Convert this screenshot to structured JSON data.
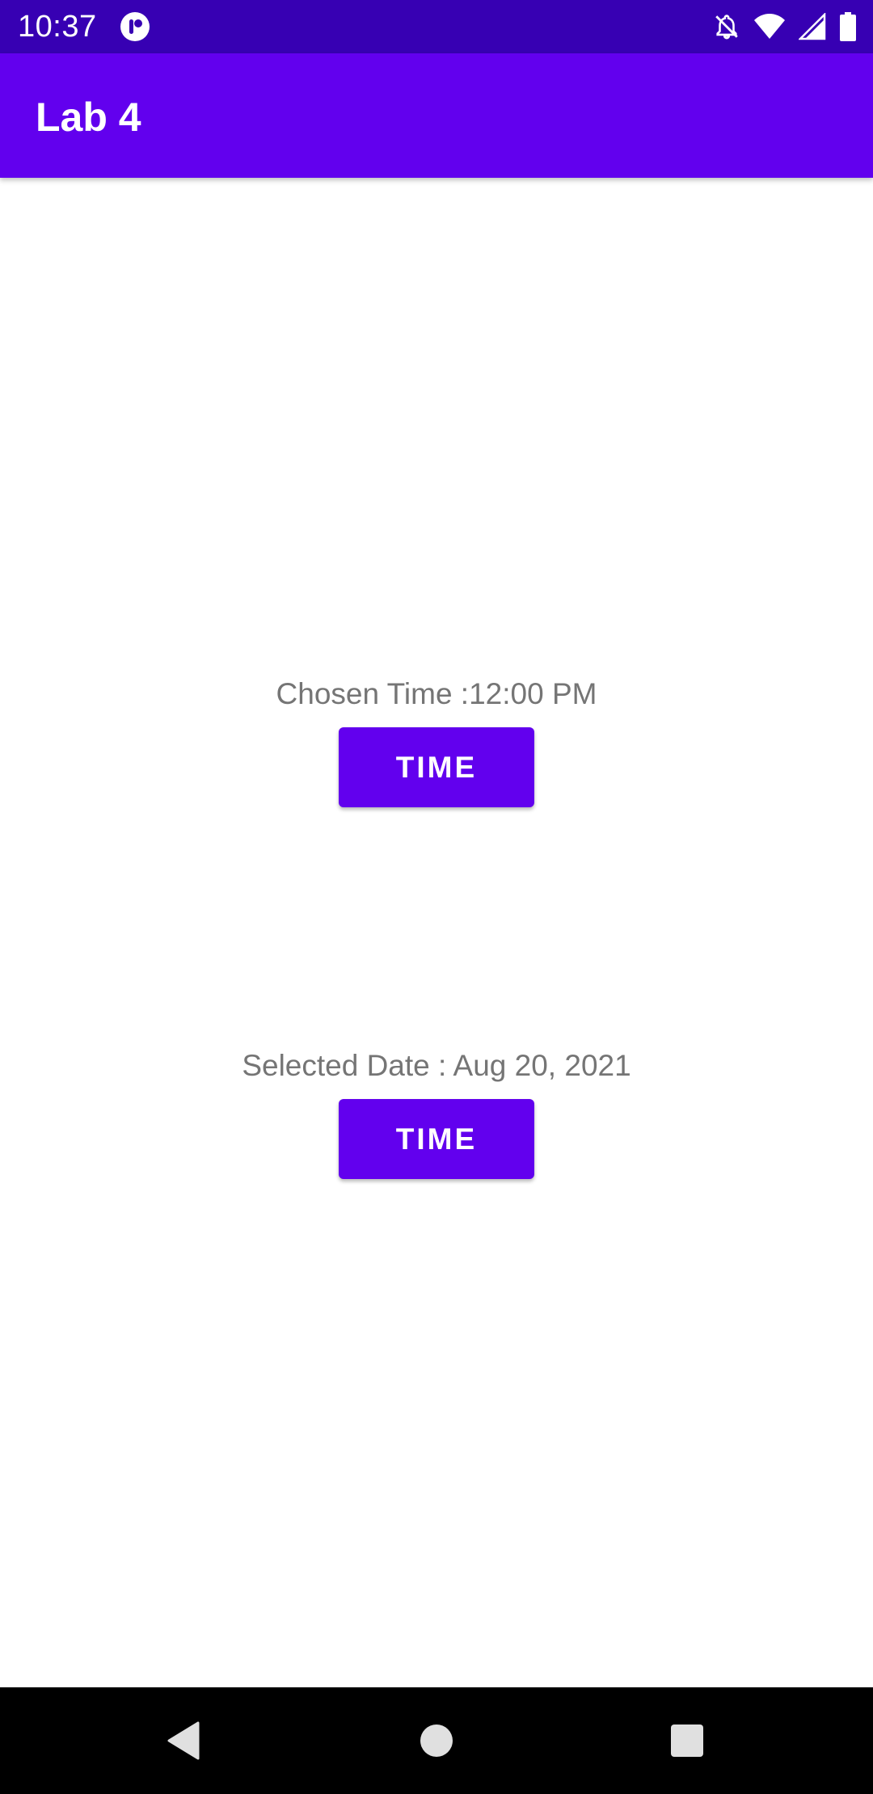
{
  "status_bar": {
    "time": "10:37",
    "icons": [
      "app-notification-icon",
      "notifications-off-icon",
      "wifi-icon",
      "cell-signal-icon",
      "battery-icon"
    ]
  },
  "app_bar": {
    "title": "Lab 4"
  },
  "main": {
    "time_label": "Chosen Time :12:00 PM",
    "time_button": "TIME",
    "date_label": "Selected Date : Aug 20, 2021",
    "date_button": "TIME"
  },
  "nav_bar": {
    "buttons": [
      "back-icon",
      "home-icon",
      "recents-icon"
    ]
  },
  "colors": {
    "status_bar": "#3700B3",
    "primary": "#6200EE",
    "label_text": "#757575",
    "background": "#FFFFFF",
    "nav_bar": "#000000"
  }
}
